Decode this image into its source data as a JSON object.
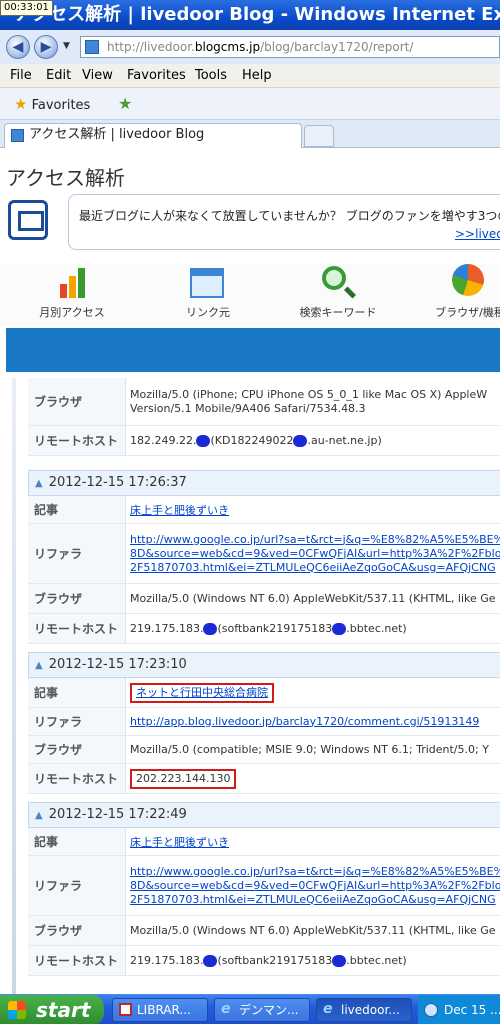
{
  "clock_badge": "00:33:01",
  "window": {
    "title": "アクセス解析 | livedoor Blog - Windows Internet Explorer"
  },
  "address": {
    "url_prefix": "http://livedoor.",
    "url_domain": "blogcms.jp",
    "url_path": "/blog/barclay1720/report/"
  },
  "menu": [
    "File",
    "Edit",
    "View",
    "Favorites",
    "Tools",
    "Help"
  ],
  "favorites": {
    "label": "Favorites"
  },
  "tab": {
    "title": "アクセス解析 | livedoor Blog"
  },
  "page": {
    "title": "アクセス解析",
    "notice_text": "最近ブログに人が来なくて放置していませんか？ ブログのファンを増やす3つの",
    "notice_link": ">>livedo",
    "nav": [
      "月別アクセス",
      "リンク元",
      "検索キーワード",
      "ブラウザ/機種"
    ]
  },
  "labels": {
    "article": "記事",
    "referrer": "リファラ",
    "browser": "ブラウザ",
    "remote_host": "リモートホスト"
  },
  "record0": {
    "browser_l1": "Mozilla/5.0 (iPhone; CPU iPhone OS 5_0_1 like Mac OS X) AppleW",
    "browser_l2": "Version/5.1 Mobile/9A406 Safari/7534.48.3",
    "host_a": "182.249.22.",
    "host_b": "(KD182249022",
    "host_c": ".au-net.ne.jp)"
  },
  "record1": {
    "timestamp": "2012-12-15 17:26:37",
    "article": "床上手と肥後ずいき",
    "ref_l1": "http://www.google.co.jp/url?sa=t&rct=j&q=%E8%82%A5%E5%BE%8C",
    "ref_l2": "8D&source=web&cd=9&ved=0CFwQFjAI&url=http%3A%2F%2Fblog.liv",
    "ref_l3": "2F51870703.html&ei=ZTLMULeQC6eiiAeZqoGoCA&usg=AFQjCNG",
    "browser": "Mozilla/5.0 (Windows NT 6.0) AppleWebKit/537.11 (KHTML, like Ge",
    "host_a": "219.175.183.",
    "host_b": "(softbank219175183",
    "host_c": ".bbtec.net)"
  },
  "record2": {
    "timestamp": "2012-12-15 17:23:10",
    "article": "ネットと行田中央総合病院",
    "referrer": "http://app.blog.livedoor.jp/barclay1720/comment.cgi/51913149",
    "browser": "Mozilla/5.0 (compatible; MSIE 9.0; Windows NT 6.1; Trident/5.0; Y",
    "host": "202.223.144.130"
  },
  "record3": {
    "timestamp": "2012-12-15 17:22:49",
    "article": "床上手と肥後ずいき",
    "ref_l1": "http://www.google.co.jp/url?sa=t&rct=j&q=%E8%82%A5%E5%BE%8C",
    "ref_l2": "8D&source=web&cd=9&ved=0CFwQFjAI&url=http%3A%2F%2Fblog.liv",
    "ref_l3": "2F51870703.html&ei=ZTLMULeQC6eiiAeZqoGoCA&usg=AFQjCNG",
    "browser": "Mozilla/5.0 (Windows NT 6.0) AppleWebKit/537.11 (KHTML, like Ge",
    "host_a": "219.175.183.",
    "host_b": "(softbank219175183",
    "host_c": ".bbtec.net)"
  },
  "taskbar": {
    "start": "start",
    "items": [
      "LIBRAR...",
      "デンマン...",
      "livedoor...",
      "Dec 15 ..."
    ]
  }
}
